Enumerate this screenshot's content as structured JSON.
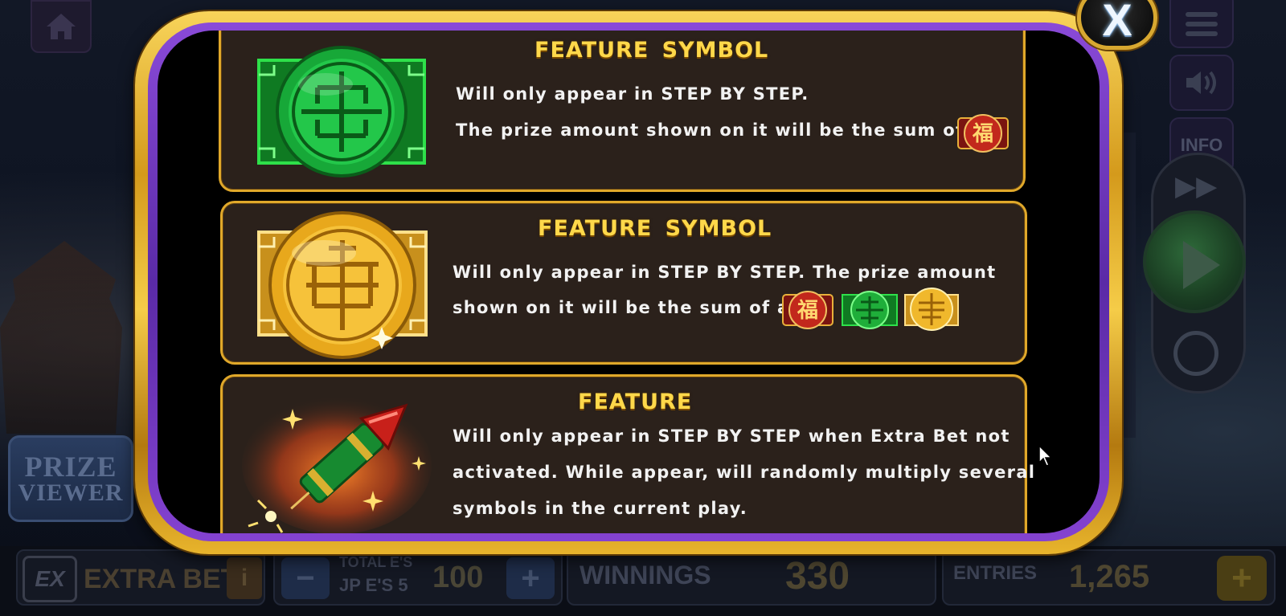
{
  "background": {
    "prize_viewer": {
      "line1": "PRIZE",
      "line2": "VIEWER"
    },
    "side_buttons": {
      "info_label": "INFO"
    },
    "bottom_bar": {
      "extra_bet_label": "EXTRA BET",
      "extra_bet_logo": "EX",
      "info_button": "i",
      "total_label": "TOTAL E'S",
      "jp_label": "JP E'S 5",
      "bet_value": "100",
      "winnings_label": "WINNINGS",
      "winnings_value": "330",
      "entries_label": "ENTRIES",
      "entries_value": "1,265"
    }
  },
  "modal": {
    "close_label": "X",
    "panels": [
      {
        "title": "FEATURE  SYMBOL",
        "lines": [
          "Will only appear in STEP BY STEP.",
          "The prize amount shown on it will be the sum of all"
        ],
        "symbol": "jade-coin-icon"
      },
      {
        "title": "FEATURE  SYMBOL",
        "lines": [
          "Will only appear in STEP BY STEP. The prize amount",
          "shown on it will be the sum of all"
        ],
        "symbol": "gold-coin-icon"
      },
      {
        "title": "FEATURE",
        "lines": [
          "Will only appear in STEP BY STEP when Extra Bet not",
          "activated. While appear, will randomly multiply several",
          "symbols in the current play."
        ],
        "symbol": "firecracker-rocket-icon"
      }
    ],
    "inline_symbols": {
      "fu": "福"
    }
  },
  "colors": {
    "title_gold": "#ffd84a",
    "frame_gold": "#e0a82a",
    "panel_bg": "#2b211b",
    "jade": "#1fae3a",
    "gold": "#e8a81c",
    "red": "#b8231c"
  }
}
